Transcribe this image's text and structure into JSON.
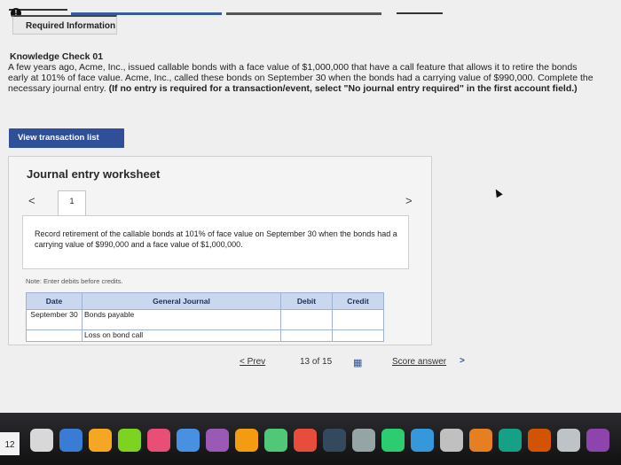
{
  "header": {
    "info_symbol": "!",
    "required_tab_label": "Required Information"
  },
  "knowledge_check": {
    "title": "Knowledge Check 01",
    "body": "A few years ago, Acme, Inc., issued callable bonds with a face value of $1,000,000 that have a call feature that allows it to retire the bonds early at 101% of face value. Acme, Inc., called these bonds on September 30 when the bonds had a carrying value of $990,000. Complete the necessary journal entry.",
    "instruction": "(If no entry is required for a transaction/event, select \"No journal entry required\" in the first account field.)"
  },
  "view_button_label": "View transaction list",
  "worksheet": {
    "title": "Journal entry worksheet",
    "nav_prev": "<",
    "nav_next": ">",
    "active_tab": "1",
    "description": "Record retirement of the callable bonds at 101% of face value on September 30 when the bonds had a carrying value of $990,000 and a face value of $1,000,000.",
    "note": "Note: Enter debits before credits.",
    "table": {
      "headers": [
        "Date",
        "General Journal",
        "Debit",
        "Credit"
      ],
      "rows": [
        {
          "date": "September 30",
          "account": "Bonds payable",
          "debit": "",
          "credit": ""
        },
        {
          "date": "",
          "account": "Loss on bond call",
          "debit": "",
          "credit": ""
        }
      ]
    }
  },
  "pagination": {
    "prev_label": "< Prev",
    "page_text": "13 of 15",
    "grid_icon": "grid-icon",
    "score_label": "Score answer",
    "score_arrow": ">"
  },
  "dock": {
    "calendar_day": "12",
    "icon_colors": [
      "#d8d8d8",
      "#3a7bd5",
      "#f5a623",
      "#7ed321",
      "#e94e77",
      "#4a90e2",
      "#9b59b6",
      "#f39c12",
      "#50c878",
      "#e74c3c",
      "#34495e",
      "#95a5a6",
      "#2ecc71",
      "#3498db",
      "#c0c0c0",
      "#e67e22",
      "#16a085",
      "#d35400",
      "#bdc3c7",
      "#8e44ad"
    ]
  }
}
